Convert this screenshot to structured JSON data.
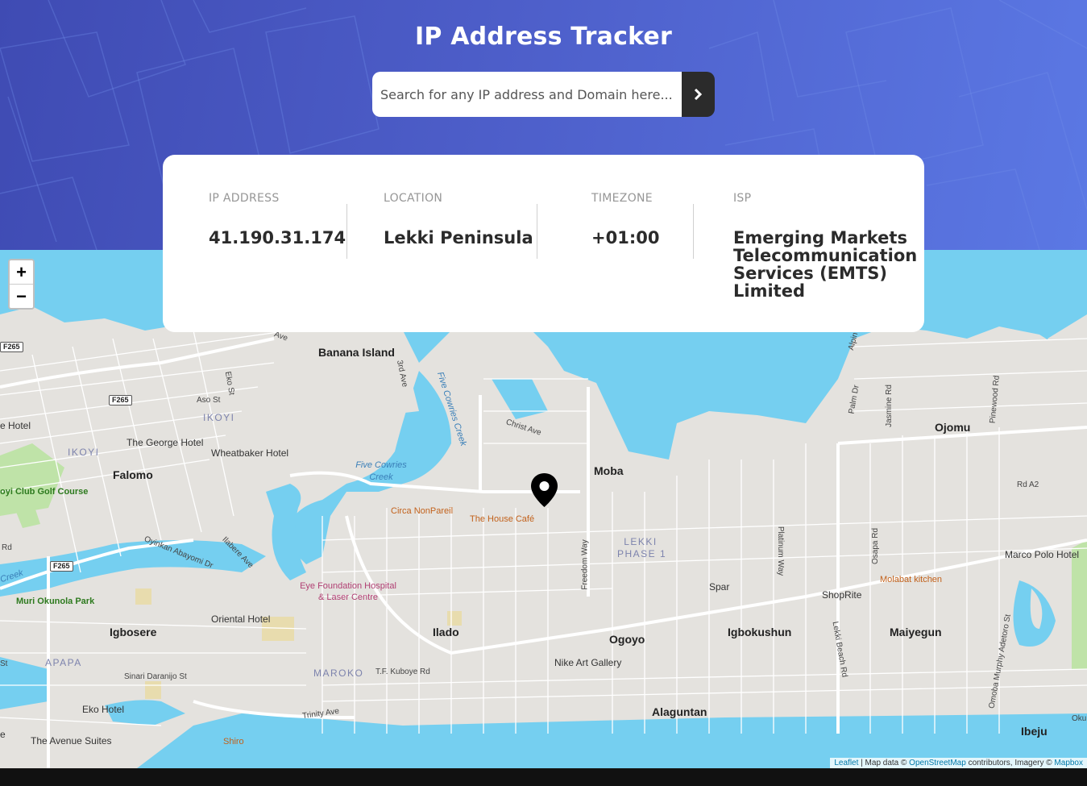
{
  "header": {
    "title": "IP Address Tracker",
    "search": {
      "placeholder": "Search for any IP address and Domain here...",
      "value": "",
      "submit_icon": "chevron-right-icon"
    }
  },
  "info": {
    "ip": {
      "label": "IP ADDRESS",
      "value": "41.190.31.174"
    },
    "location": {
      "label": "LOCATION",
      "value": "Lekki Peninsula"
    },
    "timezone": {
      "label": "TIMEZONE",
      "value": "+01:00"
    },
    "isp": {
      "label": "ISP",
      "value": "Emerging Markets Telecommunication Services (EMTS) Limited"
    }
  },
  "map": {
    "zoom_in_label": "+",
    "zoom_out_label": "−",
    "marker_icon": "location-pin-icon",
    "labels": {
      "banana_island": "Banana Island",
      "ikoyi_area": "IKOYI",
      "ikoyi": "IKOYI",
      "falomo": "Falomo",
      "moba": "Moba",
      "ojomu": "Ojomu",
      "lekki_phase_1_line1": "LEKKI",
      "lekki_phase_1_line2": "PHASE 1",
      "igbosere": "Igbosere",
      "ilado": "Ilado",
      "ogoyo": "Ogoyo",
      "igbokushun": "Igbokushun",
      "maiyegun": "Maiyegun",
      "alaguntan": "Alaguntan",
      "ibeju": "Ibeju",
      "apapa": "APAPA",
      "maroko": "MAROKO",
      "george_hotel": "The George Hotel",
      "wheatbaker": "Wheatbaker Hotel",
      "hotel_left": "e Hotel",
      "golf": "oyi Club Golf Course",
      "muri_park": "Muri Okunola Park",
      "oriental": "Oriental Hotel",
      "eko_hotel": "Eko Hotel",
      "avenue_suites": "The Avenue Suites",
      "shiro": "Shiro",
      "circa": "Circa NonPareil",
      "house_cafe": "The House Café",
      "eye_line1": "Eye Foundation Hospital",
      "eye_line2": "& Laser Centre",
      "spar": "Spar",
      "shoprite": "ShopRite",
      "molabat": "Molabat kitchen",
      "marco_polo": "Marco Polo Hotel",
      "nike": "Nike Art Gallery",
      "five_cowries_line1": "Five Cowries",
      "five_cowries_line2": "Creek",
      "five_cowries_creek": "Five Cowries Creek",
      "creek_left": "Creek",
      "aso_st": "Aso St",
      "eko_st": "Eko St",
      "third_ave": "3rd Ave",
      "christ_ave": "Christ Ave",
      "oyinkan": "Oyinkan Abayomi Dr",
      "ilabere": "Ilabere Ave",
      "freedom_way": "Freedom Way",
      "platinum_way": "Platinum Way",
      "osapa_rd": "Osapa Rd",
      "lekki_beach_rd": "Lekki Beach Rd",
      "omoba": "Omoba Murphy Adetoro St",
      "palm_dr": "Palm Dr",
      "jasmine_rd": "Jasmine Rd",
      "pinewood_rd": "Pinewood Rd",
      "rd_a2": "Rd A2",
      "sinari": "Sinari Daranijo St",
      "kuboye": "T.F. Kuboye Rd",
      "trinity": "Trinity Ave",
      "ave_top": "Ave",
      "alpine": "Alpin",
      "rd_left": "Rd",
      "st_left": "St",
      "e_left": "e",
      "oku": "Oku"
    },
    "shields": {
      "f265_a": "F265",
      "f265_b": "F265",
      "f265_c": "F265"
    },
    "attribution": {
      "leaflet": "Leaflet",
      "map_data": "| Map data ©",
      "osm": "OpenStreetMap",
      "contributors": "contributors, Imagery ©",
      "mapbox": "Mapbox"
    }
  },
  "colors": {
    "header_gradient_start": "#3f4bb3",
    "header_gradient_end": "#5b78e4",
    "water": "#75cff0",
    "land": "#e4e2de",
    "button_dark": "#2b2b2b"
  }
}
